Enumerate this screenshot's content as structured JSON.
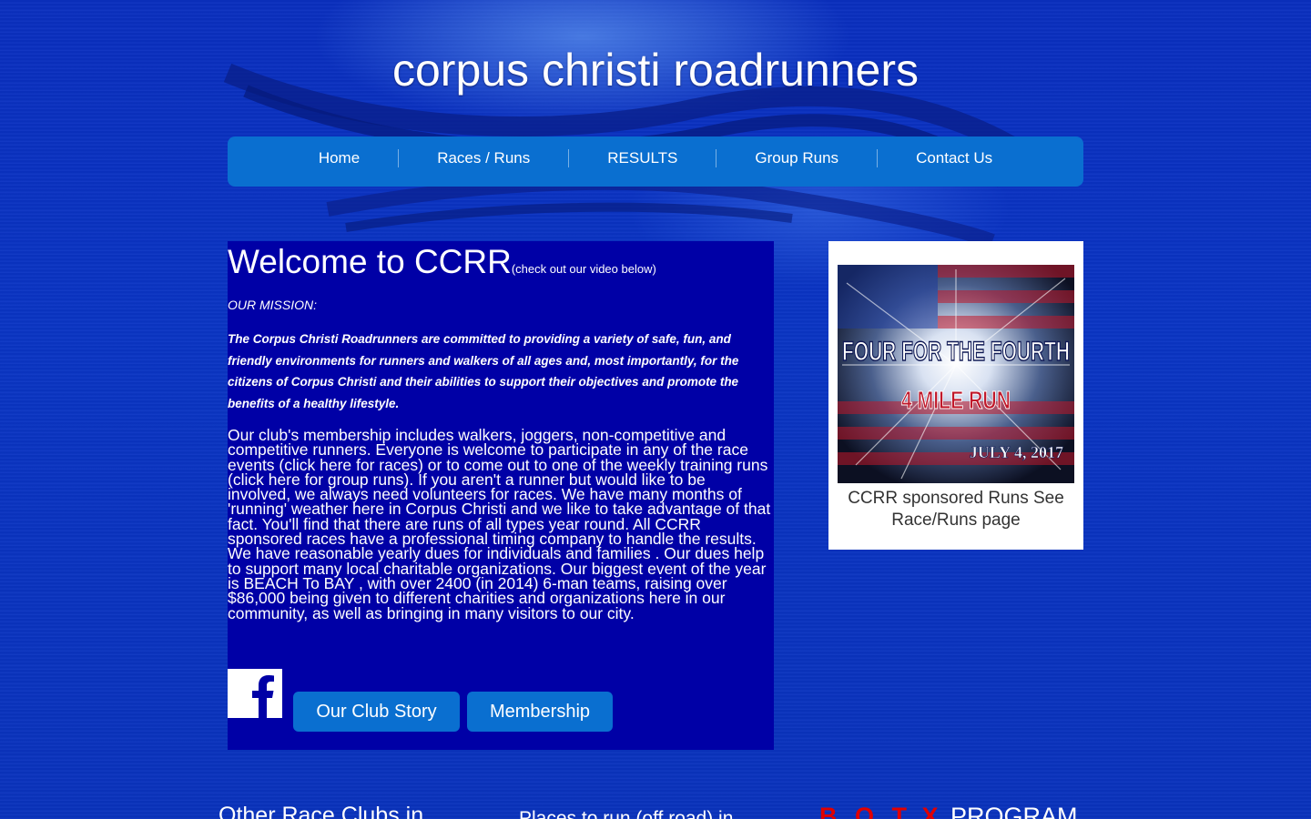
{
  "site": {
    "title": "corpus christi roadrunners"
  },
  "nav": {
    "items": [
      {
        "label": "Home"
      },
      {
        "label": "Races / Runs"
      },
      {
        "label": "RESULTS"
      },
      {
        "label": "Group Runs"
      },
      {
        "label": "Contact Us"
      }
    ]
  },
  "main": {
    "welcome_title": "Welcome to CCRR",
    "welcome_sub": "(check out our video below)",
    "mission_label": "OUR MISSION:",
    "mission_text": "The Corpus Christi Roadrunners are committed to providing a variety of safe, fun, and friendly environments for runners and walkers of all ages and, most importantly, for the citizens of Corpus Christi and their abilities to support their objectives and promote the benefits of a healthy lifestyle.",
    "paragraph1": "Our club's membership includes walkers, joggers, non-competitive and competitive runners. Everyone is welcome to participate in any of the race events (click here for races) or to come out to one of the weekly training runs (click here for group runs). If you aren't a runner but would like to be involved, we always need volunteers for races. We have many months of 'running' weather here in Corpus Christi and we like to take advantage of that fact. You'll find that there are runs of all types year round. All CCRR sponsored races have a professional timing company to handle the results.",
    "paragraph2": "We have reasonable yearly dues for individuals and families . Our dues help to support many local charitable organizations. Our biggest event of the year is BEACH To BAY , with over 2400 (in 2014) 6-man teams, raising over $86,000 being given to different charities and organizations here in our community, as well as bringing in many visitors to our city.",
    "club_story_button": "Our Club Story",
    "membership_button": "Membership"
  },
  "sidebar": {
    "promo_line1": "FOUR FOR THE FOURTH",
    "promo_line2": "4 MILE RUN",
    "promo_date": "JULY 4, 2017",
    "caption": "CCRR sponsored Runs See Race/Runs page"
  },
  "bottom": {
    "heading1": "Other Race Clubs in",
    "heading2": "Places to run (off road) in",
    "heading3_accent": "B.O.T.X",
    "heading3_rest": " PROGRAM"
  },
  "icons": {
    "facebook": "facebook-icon"
  },
  "colors": {
    "nav_bg": "#0a6fd0",
    "main_box_bg": "#0000a6",
    "page_bg": "#0a33bd",
    "botx_red": "#e00000"
  }
}
